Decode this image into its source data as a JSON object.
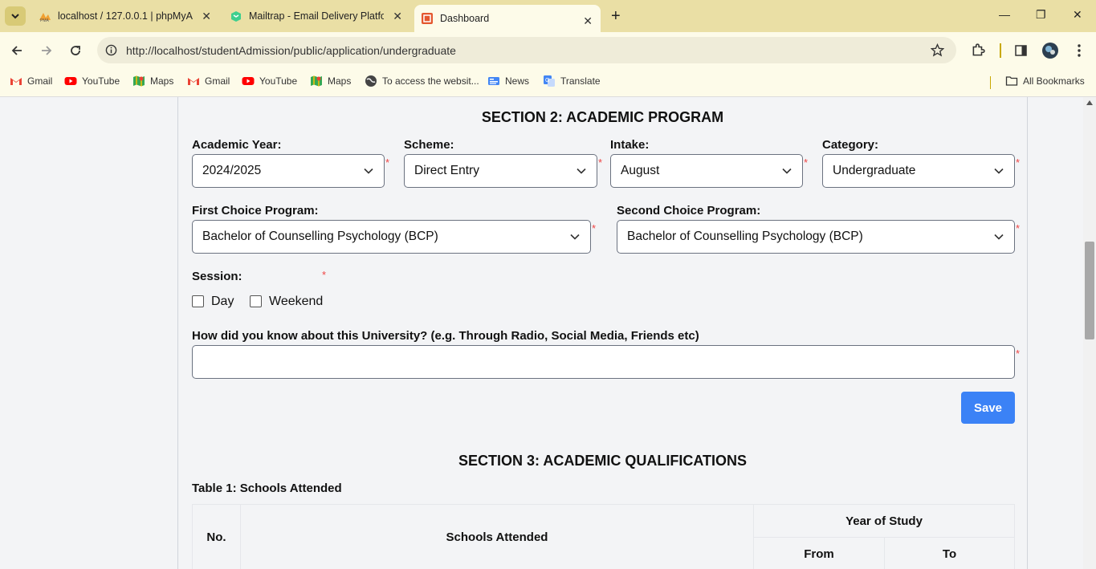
{
  "browser": {
    "tabs": [
      {
        "title": "localhost / 127.0.0.1 | phpMyAd",
        "favicon": "phpmyadmin-icon"
      },
      {
        "title": "Mailtrap - Email Delivery Platfor",
        "favicon": "mailtrap-icon"
      },
      {
        "title": "Dashboard",
        "favicon": "dashboard-icon",
        "active": true
      }
    ],
    "url": "http://localhost/studentAdmission/public/application/undergraduate",
    "bookmarks": [
      {
        "label": "Gmail",
        "icon": "gmail-icon"
      },
      {
        "label": "YouTube",
        "icon": "youtube-icon"
      },
      {
        "label": "Maps",
        "icon": "maps-icon"
      },
      {
        "label": "Gmail",
        "icon": "gmail-icon"
      },
      {
        "label": "YouTube",
        "icon": "youtube-icon"
      },
      {
        "label": "Maps",
        "icon": "maps-icon"
      },
      {
        "label": "To access the websit...",
        "icon": "globe-icon"
      },
      {
        "label": "News",
        "icon": "news-icon"
      },
      {
        "label": "Translate",
        "icon": "translate-icon"
      }
    ],
    "all_bookmarks": "All Bookmarks"
  },
  "section2": {
    "title": "SECTION 2: ACADEMIC PROGRAM",
    "academic_year": {
      "label": "Academic Year:",
      "value": "2024/2025"
    },
    "scheme": {
      "label": "Scheme:",
      "value": "Direct Entry"
    },
    "intake": {
      "label": "Intake:",
      "value": "August"
    },
    "category": {
      "label": "Category:",
      "value": "Undergraduate"
    },
    "first_choice": {
      "label": "First Choice Program:",
      "value": "Bachelor of Counselling Psychology (BCP)"
    },
    "second_choice": {
      "label": "Second Choice Program:",
      "value": "Bachelor of Counselling Psychology (BCP)"
    },
    "session": {
      "label": "Session:",
      "options": [
        "Day",
        "Weekend"
      ]
    },
    "how_know": {
      "label": "How did you know about this University? (e.g. Through Radio, Social Media, Friends etc)",
      "value": ""
    },
    "required_mark": "*",
    "save_label": "Save"
  },
  "section3": {
    "title": "SECTION 3: ACADEMIC QUALIFICATIONS",
    "table_title": "Table 1: Schools Attended",
    "headers": {
      "no": "No.",
      "schools": "Schools Attended",
      "year": "Year of Study",
      "from": "From",
      "to": "To"
    }
  },
  "colors": {
    "accent": "#3b82f6",
    "required": "#ef4444",
    "titlebar": "#eadfa5"
  }
}
